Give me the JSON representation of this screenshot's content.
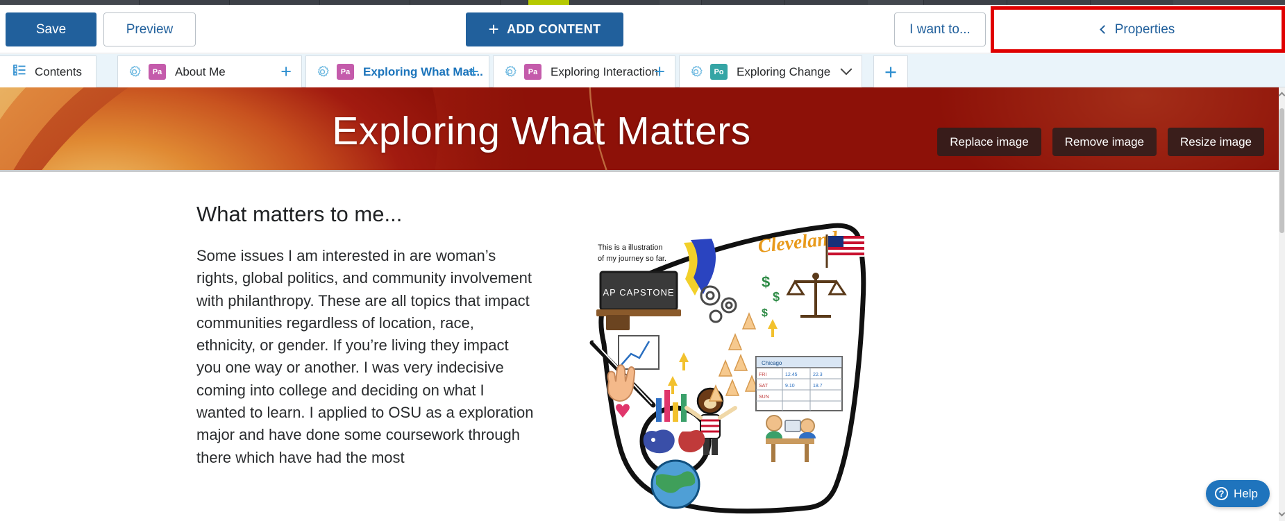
{
  "topbar": {
    "save_label": "Save",
    "preview_label": "Preview",
    "add_content_label": "ADD CONTENT",
    "add_content_icon": "plus-icon",
    "i_want_to_label": "I want to...",
    "properties_label": "Properties",
    "properties_icon": "chevron-left-icon",
    "properties_highlight_color": "#e00000",
    "primary_color": "#21609c"
  },
  "tabbar": {
    "contents": {
      "label": "Contents",
      "icon": "list-contents-icon"
    },
    "tabs": [
      {
        "label": "About Me",
        "chip": "Pa",
        "chip_color": "#c45bab",
        "gear_icon": "gear-icon",
        "action_icon": "plus-icon",
        "active": false
      },
      {
        "label": "Exploring What Mat...",
        "chip": "Pa",
        "chip_color": "#c45bab",
        "gear_icon": "gear-icon",
        "action_icon": "plus-icon",
        "active": true
      },
      {
        "label": "Exploring Interaction",
        "chip": "Pa",
        "chip_color": "#c45bab",
        "gear_icon": "gear-icon",
        "action_icon": "plus-icon",
        "active": false
      },
      {
        "label": "Exploring Change",
        "chip": "Po",
        "chip_color": "#35a5a5",
        "gear_icon": "gear-icon",
        "action_icon": "chevron-down-icon",
        "active": false
      }
    ],
    "add_tab_icon": "plus-icon"
  },
  "banner": {
    "title": "Exploring What Matters",
    "buttons": [
      {
        "label": "Replace image"
      },
      {
        "label": "Remove image"
      },
      {
        "label": "Resize image"
      }
    ]
  },
  "content": {
    "heading": "What matters to me...",
    "paragraph": "Some issues I am interested in are woman’s rights, global politics, and community involvement with philanthropy. These are all topics that impact communities regardless of location, race, ethnicity, or gender. If you’re living they impact you one way or another. I was very indecisive coming into college and deciding on what I wanted to learn. I applied to OSU as a exploration major and have done some coursework through there which have had the most",
    "illustration": {
      "name": "ohio-journey-collage",
      "labels": [
        "This is a illustration of my journey so far.",
        "AP CAPSTONE",
        "Cleveland"
      ]
    }
  },
  "help": {
    "label": "Help",
    "icon": "question-mark-icon"
  }
}
